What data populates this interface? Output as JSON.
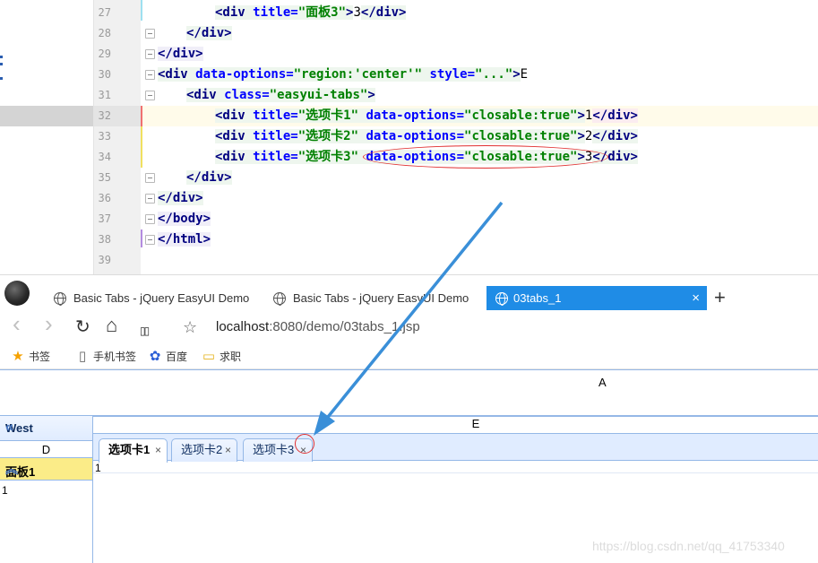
{
  "editor": {
    "lines": [
      {
        "num": "27"
      },
      {
        "num": "28"
      },
      {
        "num": "29"
      },
      {
        "num": "30"
      },
      {
        "num": "31"
      },
      {
        "num": "32"
      },
      {
        "num": "33"
      },
      {
        "num": "34"
      },
      {
        "num": "35"
      },
      {
        "num": "36"
      },
      {
        "num": "37"
      },
      {
        "num": "38"
      },
      {
        "num": "39"
      }
    ],
    "code": {
      "l27_tag": "<div",
      "l27_attr": " title=",
      "l27_val": "\"面板3\"",
      "l27_end": ">",
      "l27_text": "3",
      "l27_close": "</div>",
      "l28": "</div>",
      "l29": "</div>",
      "l30_tag": "<div",
      "l30_attr1": " data-options=",
      "l30_val1": "\"region:'center'\"",
      "l30_attr2": " style=",
      "l30_val2": "\"...\"",
      "l30_end": ">",
      "l30_text": "E",
      "l31_tag": "<div",
      "l31_attr": " class=",
      "l31_val": "\"easyui-tabs\"",
      "l31_end": ">",
      "l32_tag": "<div",
      "l32_attr1": " title=",
      "l32_val1": "\"选项卡1\"",
      "l32_attr2": " data-options=",
      "l32_val2": "\"closable:true\"",
      "l32_end": ">",
      "l32_text": "1",
      "l32_close": "</div>",
      "l33_tag": "<div",
      "l33_attr1": " title=",
      "l33_val1": "\"选项卡2\"",
      "l33_attr2": " data-options=",
      "l33_val2": "\"closable:true\"",
      "l33_end": ">",
      "l33_text": "2",
      "l33_close": "</div>",
      "l34_tag": "<div",
      "l34_attr1": " title=",
      "l34_val1": "\"选项卡3\"",
      "l34_attr2": " data-options=",
      "l34_val2": "\"closable:true\"",
      "l34_end": ">",
      "l34_text": "3",
      "l34_close": "</div>",
      "l35": "</div>",
      "l36": "</div>",
      "l37": "</body>",
      "l38": "</html>"
    }
  },
  "browser": {
    "tabs": [
      {
        "label": "Basic Tabs - jQuery EasyUI Demo"
      },
      {
        "label": "Basic Tabs - jQuery EasyUI Demo"
      },
      {
        "label": "03tabs_1"
      }
    ],
    "close_glyph": "×",
    "new_tab_glyph": "+",
    "nav": {
      "back": "‹",
      "forward": "›",
      "refresh": "↻",
      "home": "⌂",
      "reader": "▯▯",
      "favorite": "☆"
    },
    "url_host": "localhost",
    "url_rest": ":8080/demo/03tabs_1.jsp",
    "bookmarks": [
      {
        "label": "书签",
        "icon": "★"
      },
      {
        "label": "手机书签",
        "icon": "▯"
      },
      {
        "label": "百度",
        "icon": "✿"
      },
      {
        "label": "求职",
        "icon": "▭"
      }
    ]
  },
  "page": {
    "north_text": "A",
    "west_title": "West",
    "west_collapse": "«",
    "west_text": "D",
    "accordion_title": "面板1",
    "accordion_chevron": "︽",
    "accordion_body": "1",
    "center_title": "E",
    "tabs": [
      {
        "label": "选项卡1",
        "close": "×"
      },
      {
        "label": "选项卡2",
        "close": "×"
      },
      {
        "label": "选项卡3",
        "close": "×"
      }
    ],
    "tab_content": "1"
  },
  "watermark": "https://blog.csdn.net/qq_41753340"
}
